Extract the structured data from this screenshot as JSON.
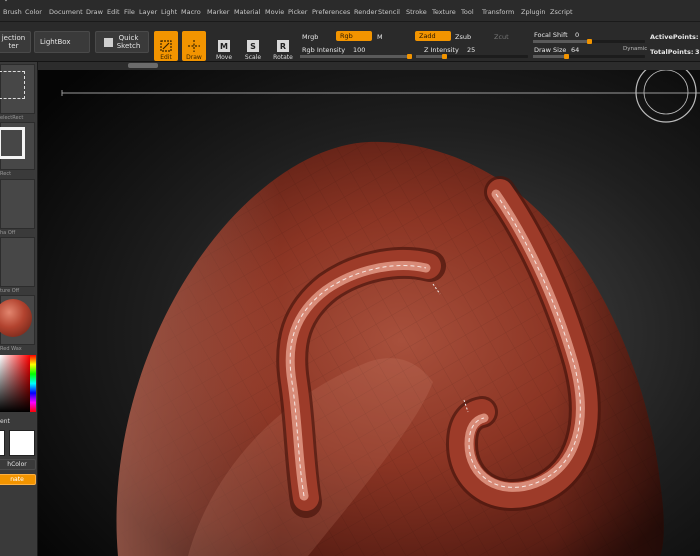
{
  "menubar": {
    "items": [
      "Brush",
      "Color",
      "Document",
      "Draw",
      "Edit",
      "File",
      "Layer",
      "Light",
      "Macro",
      "Marker",
      "Material",
      "Movie",
      "Picker",
      "Preferences",
      "Render",
      "Stencil",
      "Stroke",
      "Texture",
      "Tool",
      "Transform",
      "Zplugin",
      "Zscript"
    ]
  },
  "toolbar": {
    "projection_master": "jection\nter",
    "lightbox": "LightBox",
    "quick_sketch": "Quick\nSketch",
    "edit": "Edit",
    "draw": "Draw",
    "move": "Move",
    "scale": "Scale",
    "rotate": "Rotate",
    "move_glyph": "M",
    "scale_glyph": "S",
    "rotate_glyph": "R",
    "mrgb": "Mrgb",
    "rgb": "Rgb",
    "m": "M",
    "rgb_intensity_label": "Rgb  Intensity",
    "rgb_intensity_value": "100",
    "zadd": "Zadd",
    "zsub": "Zsub",
    "zcut": "Zcut",
    "z_intensity_label": "Z  Intensity",
    "z_intensity_value": "25",
    "focal_shift_label": "Focal  Shift",
    "focal_shift_value": "0",
    "draw_size_label": "Draw  Size",
    "draw_size_value": "64",
    "dynamic": "Dynamic",
    "active_points": "ActivePoints:",
    "total_points": "TotalPoints:",
    "total_points_value_frag": "3",
    "rgb_intensity_level": 1.0,
    "z_intensity_level": 0.25,
    "focal_shift_level": 0.5,
    "draw_size_level": 0.3
  },
  "leftpanel": {
    "captions": [
      "electRect",
      "Rect",
      "ha  Off",
      "ture  Off",
      "Red  Wax",
      "ent",
      "hColor",
      "nate"
    ]
  },
  "colors": {
    "accent": "#f29400",
    "clay": "#8c3524",
    "clay_light": "#d46a55"
  }
}
